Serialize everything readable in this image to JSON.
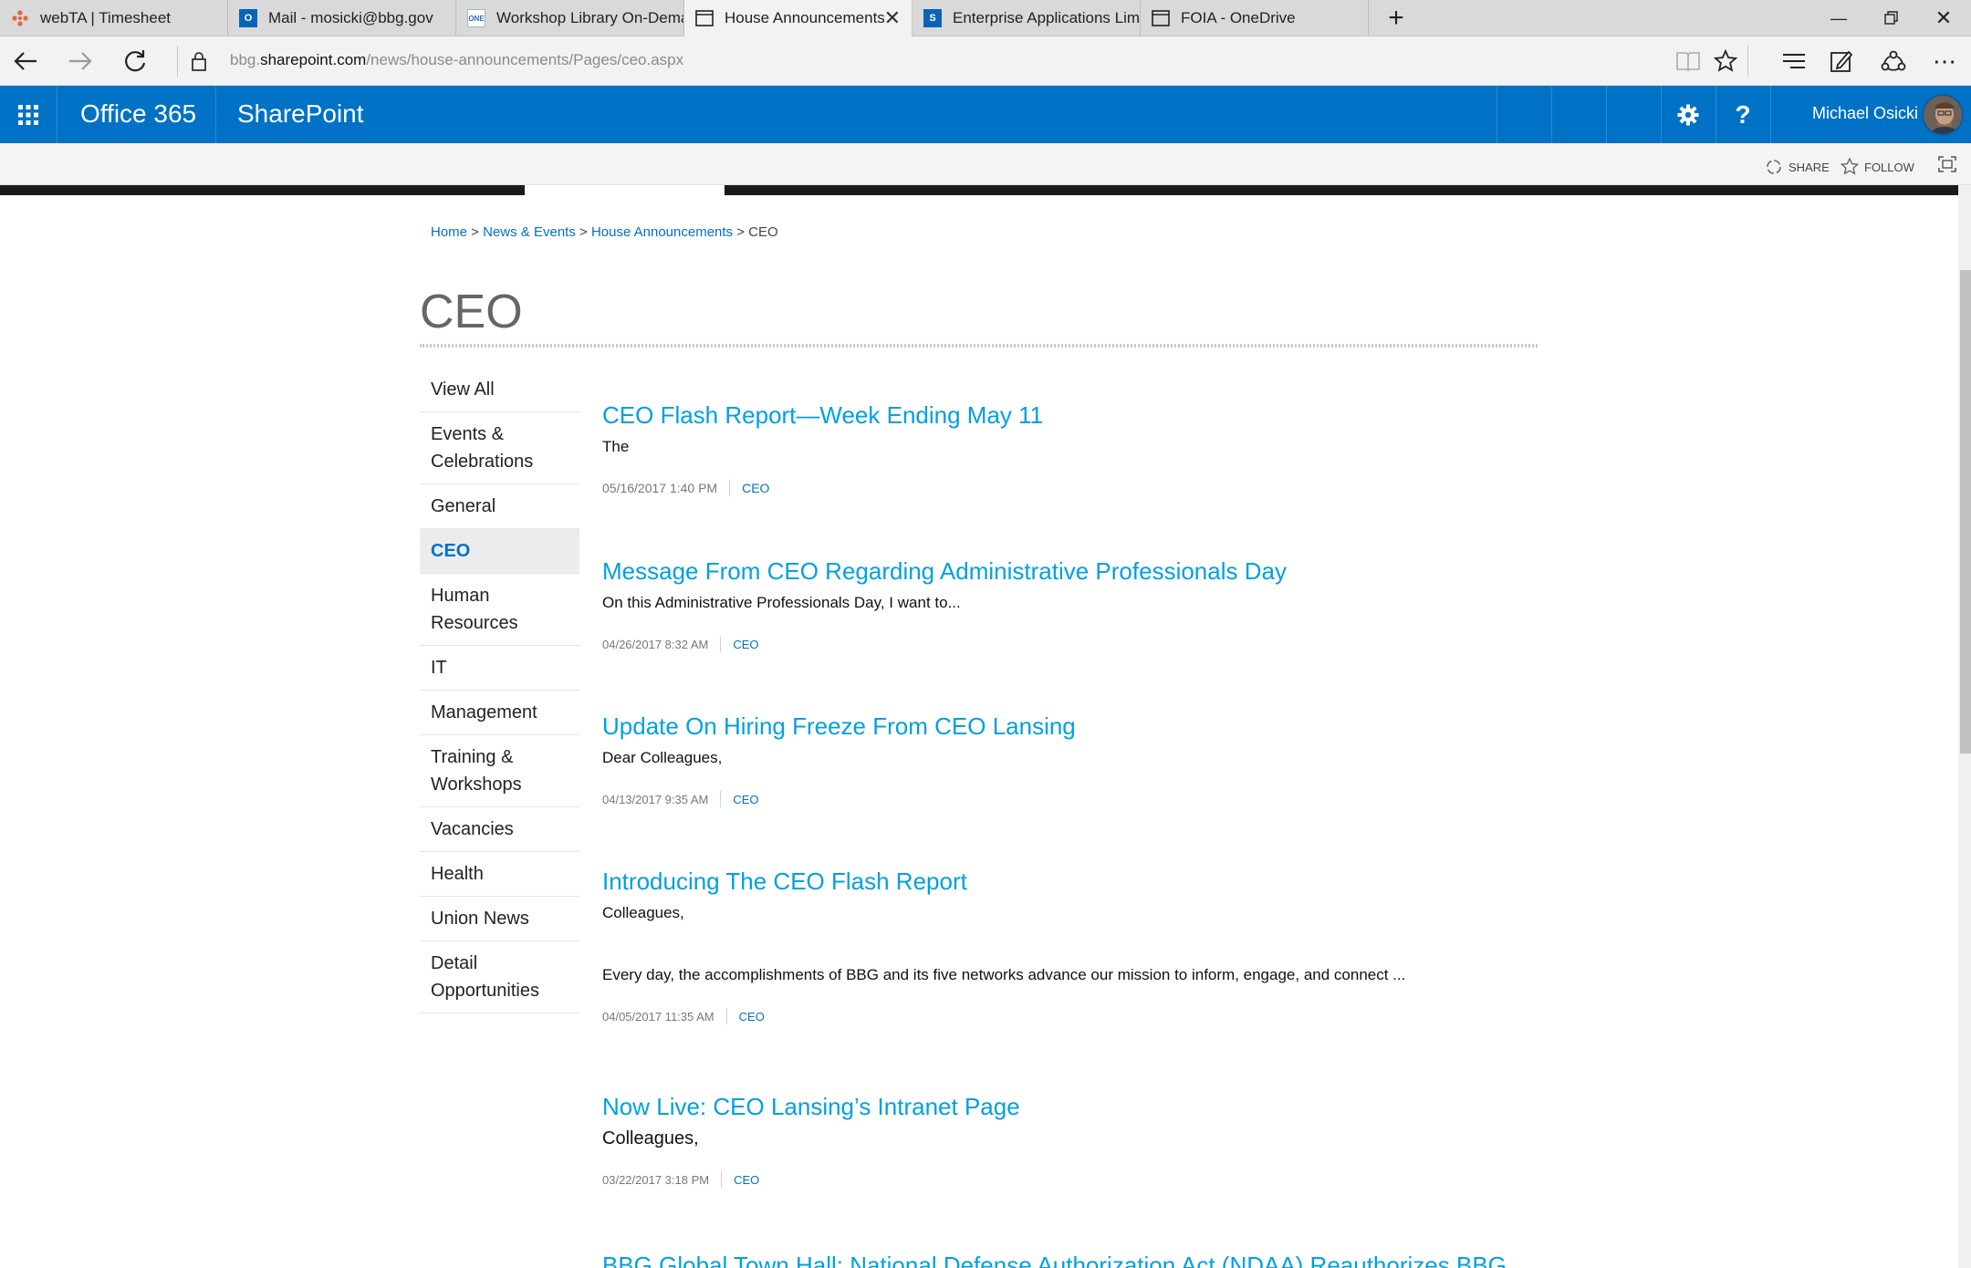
{
  "browser": {
    "tabs": [
      {
        "title": "webTA | Timesheet",
        "icon": "webta-icon"
      },
      {
        "title": "Mail - mosicki@bbg.gov",
        "icon": "outlook-icon"
      },
      {
        "title": "Workshop Library On-Dema",
        "icon": "one-icon"
      },
      {
        "title": "House Announcements",
        "icon": "page-icon",
        "active": true
      },
      {
        "title": "Enterprise Applications Limi",
        "icon": "sharepoint-icon"
      },
      {
        "title": "FOIA - OneDrive",
        "icon": "page-icon"
      }
    ],
    "url_prefix": "bbg.",
    "url_domain": "sharepoint.com",
    "url_path": "/news/house-announcements/Pages/ceo.aspx"
  },
  "suite": {
    "app_name": "Office 365",
    "product": "SharePoint",
    "user": "Michael Osicki",
    "colors": {
      "brand": "#0072c6"
    }
  },
  "ribbon": {
    "share": "SHARE",
    "follow": "FOLLOW"
  },
  "breadcrumb": {
    "home": "Home",
    "sep1": " > ",
    "news": "News & Events",
    "sep2": " > ",
    "house": "House Announcements",
    "sep3": " > ",
    "current": "CEO"
  },
  "page": {
    "title": "CEO"
  },
  "nav": [
    {
      "label": "View All"
    },
    {
      "label": "Events & Celebrations"
    },
    {
      "label": "General"
    },
    {
      "label": "CEO",
      "selected": true
    },
    {
      "label": "Human Resources"
    },
    {
      "label": "IT"
    },
    {
      "label": "Management"
    },
    {
      "label": "Training & Workshops"
    },
    {
      "label": "Vacancies"
    },
    {
      "label": "Health"
    },
    {
      "label": "Union News"
    },
    {
      "label": "Detail Opportunities"
    }
  ],
  "articles": [
    {
      "title": "CEO Flash Report—Week Ending May 11",
      "excerpt": "The",
      "date": "05/16/2017 1:40 PM",
      "category": "CEO"
    },
    {
      "title": "Message From CEO Regarding Administrative Professionals Day",
      "excerpt": "On this Administrative Professionals Day, I want to...",
      "date": "04/26/2017 8:32 AM",
      "category": "CEO"
    },
    {
      "title": "Update On Hiring Freeze From CEO Lansing",
      "excerpt": "Dear Colleagues,",
      "date": "04/13/2017 9:35 AM",
      "category": "CEO"
    },
    {
      "title": "Introducing The CEO Flash Report",
      "excerpt": "Colleagues,",
      "excerpt2": "Every day, the accomplishments of BBG and its five networks advance our mission to inform, engage, and connect ...",
      "date": "04/05/2017 11:35 AM",
      "category": "CEO"
    },
    {
      "title": "Now Live: CEO Lansing’s Intranet Page",
      "excerpt": "Colleagues,",
      "date": "03/22/2017 3:18 PM",
      "category": "CEO"
    },
    {
      "title": "BBG Global Town Hall: National Defense Authorization Act (NDAA) Reauthorizes BBG"
    }
  ]
}
